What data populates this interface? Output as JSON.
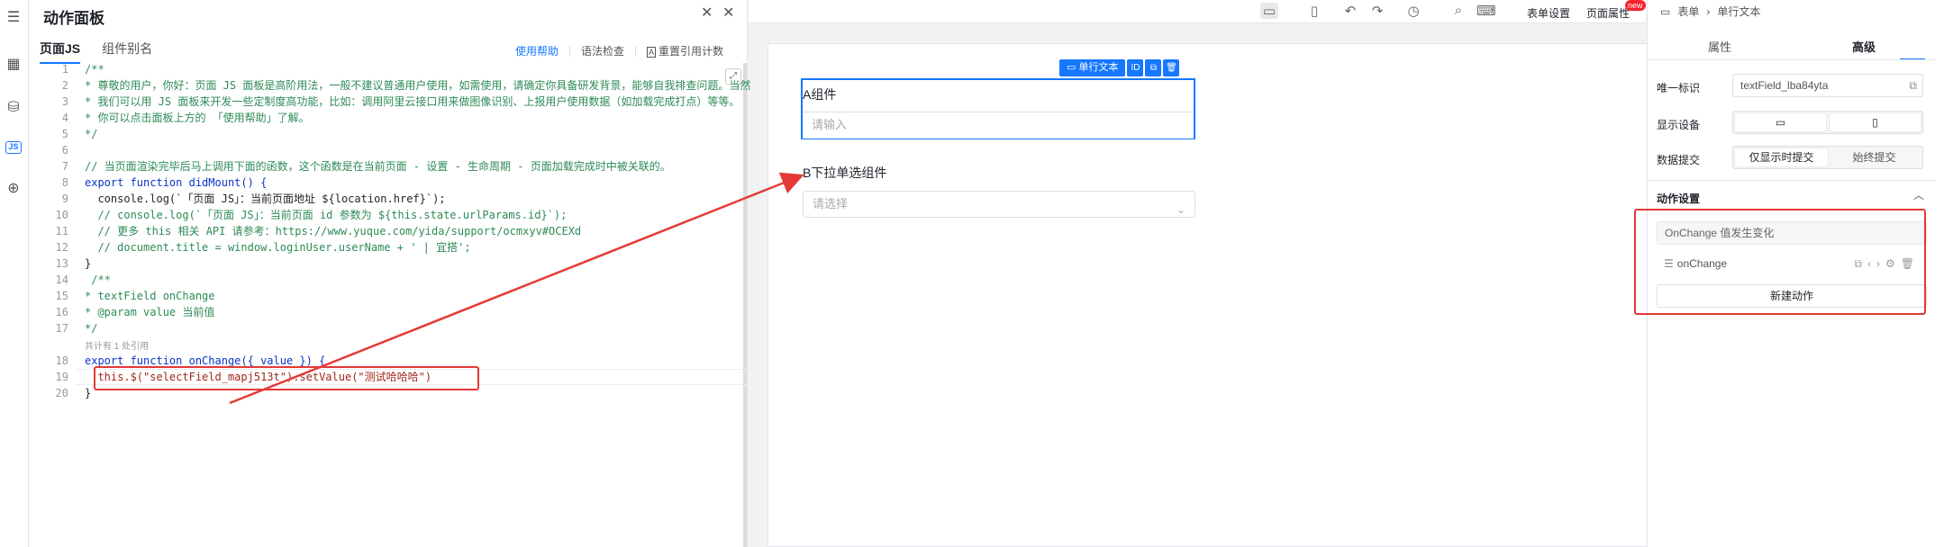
{
  "rail": {
    "icons": [
      "outline-icon",
      "components-icon",
      "datasource-icon",
      "js-icon",
      "globe-icon"
    ],
    "js_label": "JS"
  },
  "action_panel": {
    "title": "动作面板",
    "tabs": [
      {
        "label": "页面JS",
        "active": true
      },
      {
        "label": "组件别名",
        "active": false
      }
    ],
    "help_label": "使用帮助",
    "lint_label": "语法检查",
    "reset_label": "重置引用计数",
    "ref_hint": "共计有 1 处引用",
    "code_lines": [
      "/**",
      "* 尊敬的用户，你好：页面 JS 面板是高阶用法，一般不建议普通用户使用，如需使用，请确定你具备研发背景，能够自我排查问题。当然",
      "* 我们可以用 JS 面板来开发一些定制度高功能，比如：调用阿里云接口用来做图像识别、上报用户使用数据（如加载完成打点）等等。",
      "* 你可以点击面板上方的 「使用帮助」了解。",
      "*/",
      "",
      "// 当页面渲染完毕后马上调用下面的函数，这个函数是在当前页面 - 设置 - 生命周期 - 页面加载完成时中被关联的。",
      "export function didMount() {",
      "  console.log(`「页面 JS」：当前页面地址 ${location.href}`);",
      "  // console.log(`「页面 JS」：当前页面 id 参数为 ${this.state.urlParams.id}`);",
      "  // 更多 this 相关 API 请参考：https://www.yuque.com/yida/support/ocmxyv#OCEXd",
      "  // document.title = window.loginUser.userName + ' | 宜搭';",
      "}",
      " /**",
      "* textField onChange",
      "* @param value 当前值",
      "*/",
      "export function onChange({ value }) {",
      "  this.$(\"selectField_mapj513t\").setValue(\"测试哈哈哈\")",
      "}"
    ]
  },
  "toolbar": {
    "icons": [
      "desktop-icon",
      "mobile-icon",
      "undo-icon",
      "redo-icon",
      "history-icon",
      "search-icon",
      "keyboard-icon"
    ],
    "form_settings": "表单设置",
    "page_props": "页面属性",
    "new_badge": "new"
  },
  "canvas": {
    "comp_toolbar_label": "单行文本",
    "comp_toolbar_id": "ID",
    "field_a_label": "A组件",
    "field_a_placeholder": "请输入",
    "field_b_label": "B下拉单选组件",
    "field_b_placeholder": "请选择"
  },
  "right_panel": {
    "breadcrumb": [
      "表单",
      "单行文本"
    ],
    "tabs": [
      {
        "label": "属性",
        "active": false
      },
      {
        "label": "高级",
        "active": true
      }
    ],
    "unique_id_label": "唯一标识",
    "unique_id_value": "textField_lba84yta",
    "display_device_label": "显示设备",
    "data_submit_label": "数据提交",
    "submit_options": [
      "仅显示时提交",
      "始终提交"
    ],
    "submit_selected": "仅显示时提交",
    "action_settings_label": "动作设置",
    "onchange_title": "OnChange 值发生变化",
    "onchange_handler": "onChange",
    "new_action_label": "新建动作"
  },
  "colors": {
    "accent": "#1677ff",
    "annotation": "#e53935"
  }
}
